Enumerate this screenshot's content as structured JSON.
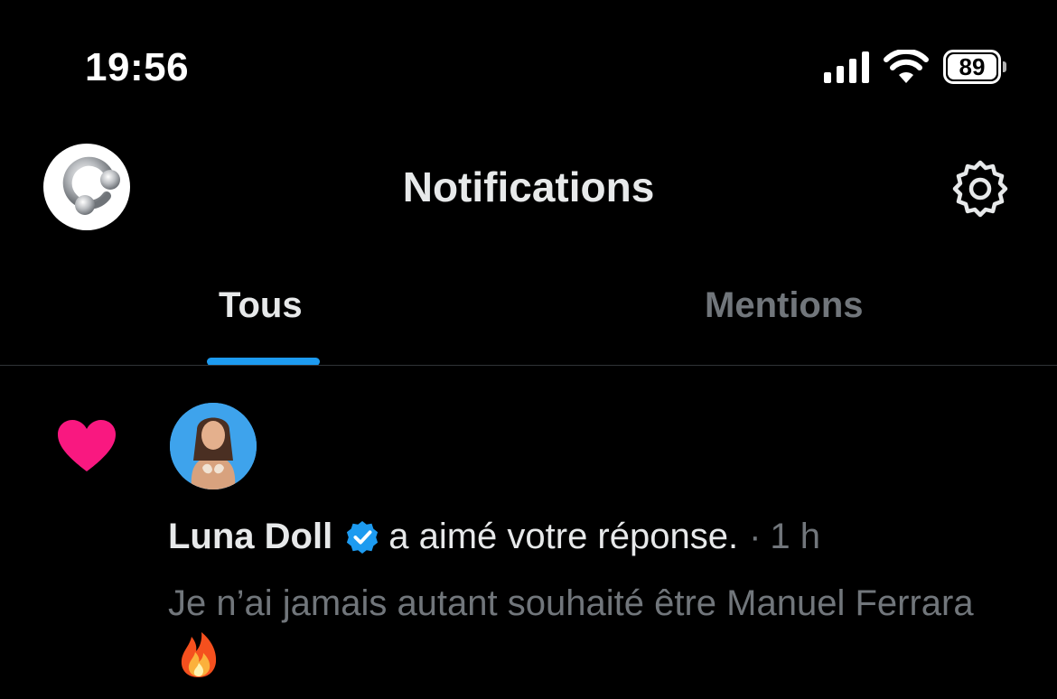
{
  "status_bar": {
    "time": "19:56",
    "battery": "89",
    "icons": [
      "signal-icon",
      "wifi-icon",
      "battery-icon"
    ]
  },
  "header": {
    "title": "Notifications",
    "avatar": "profile-avatar",
    "settings_icon": "gear-icon"
  },
  "tabs": [
    {
      "label": "Tous",
      "active": true
    },
    {
      "label": "Mentions",
      "active": false
    }
  ],
  "colors": {
    "accent": "#1d9bf0",
    "like": "#f91880",
    "secondary_text": "#71767b"
  },
  "notification": {
    "type_icon": "heart-icon",
    "user_name": "Luna Doll",
    "verified_icon": "verified-badge-icon",
    "action": "a aimé votre réponse.",
    "separator": "·",
    "time": "1 h",
    "text": "Je n’ai jamais autant souhaité être Manuel Ferrara",
    "emoji_icon": "fire-emoji-icon"
  }
}
